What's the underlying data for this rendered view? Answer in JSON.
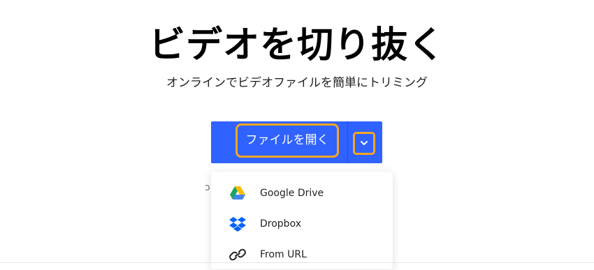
{
  "hero": {
    "title": "ビデオを切り抜く",
    "subtitle": "オンラインでビデオファイルを簡単にトリミング"
  },
  "open_file": {
    "label": "ファイルを開く",
    "button_color": "#2f62ff",
    "focus_color": "#f5a623"
  },
  "side_glyph": "ↄ",
  "menu": {
    "items": [
      {
        "label": "Google Drive",
        "icon": "google-drive-icon"
      },
      {
        "label": "Dropbox",
        "icon": "dropbox-icon"
      },
      {
        "label": "From URL",
        "icon": "link-icon"
      }
    ]
  }
}
